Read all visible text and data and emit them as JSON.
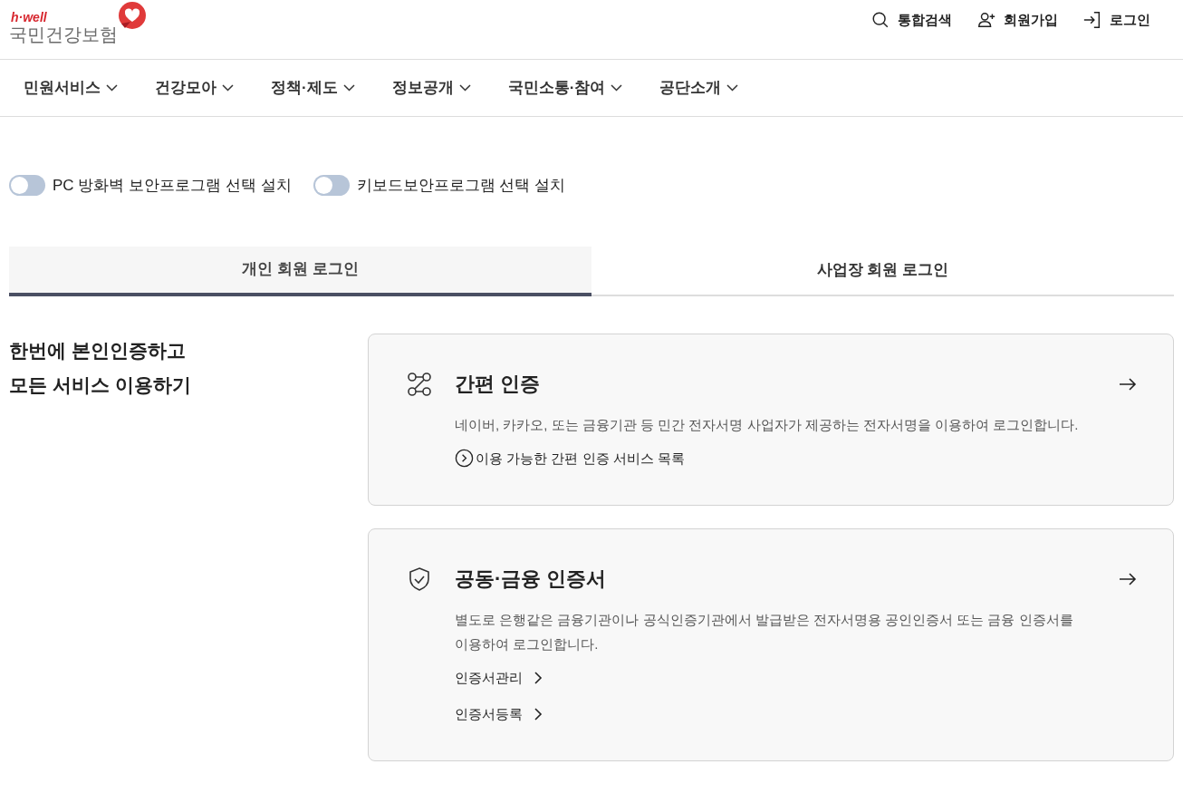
{
  "logo": {
    "tagline": "h·well",
    "name": "국민건강보험"
  },
  "utility_links": [
    {
      "kind": "search",
      "label": "통합검색"
    },
    {
      "kind": "signup",
      "label": "회원가입"
    },
    {
      "kind": "login",
      "label": "로그인"
    }
  ],
  "nav": [
    "민원서비스",
    "건강모아",
    "정책·제도",
    "정보공개",
    "국민소통·참여",
    "공단소개"
  ],
  "toggles": [
    {
      "label": "PC 방화벽 보안프로그램 선택 설치",
      "on": false
    },
    {
      "label": "키보드보안프로그램 선택 설치",
      "on": false
    }
  ],
  "tabs": [
    {
      "label": "개인 회원 로그인",
      "selected": true
    },
    {
      "label": "사업장 회원 로그인",
      "selected": false
    }
  ],
  "headline": [
    "한번에 본인인증하고",
    "모든 서비스 이용하기"
  ],
  "cards": [
    {
      "kind": "simple",
      "title": "간편 인증",
      "description": "네이버, 카카오, 또는 금융기관 등 민간 전자서명 사업자가 제공하는 전자서명을 이용하여 로그인합니다.",
      "links": [
        {
          "kind": "circle",
          "label": "이용 가능한 간편 인증 서비스 목록"
        }
      ]
    },
    {
      "kind": "certificate",
      "title": "공동·금융 인증서",
      "description": "별도로 은행같은 금융기관이나 공식인증기관에서 발급받은 전자서명용 공인인증서 또는 금융 인증서를 이용하여 로그인합니다.",
      "links": [
        {
          "kind": "chevron",
          "label": "인증서관리"
        },
        {
          "kind": "chevron",
          "label": "인증서등록"
        }
      ]
    }
  ]
}
